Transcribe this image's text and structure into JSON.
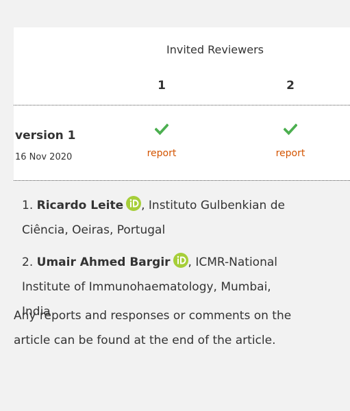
{
  "panel": {
    "heading": "Invited Reviewers",
    "reviewer_columns": [
      "1",
      "2"
    ]
  },
  "version": {
    "label": "version 1",
    "date": "16 Nov 2020",
    "reports": [
      {
        "status_icon": "checkmark-icon",
        "link_label": "report"
      },
      {
        "status_icon": "checkmark-icon",
        "link_label": "report"
      }
    ]
  },
  "reviewers": [
    {
      "number": "1.",
      "name": "Ricardo Leite",
      "orcid_icon": "orcid-icon",
      "affiliation_line1": ", Instituto Gulbenkian de",
      "affiliation_line2": "Ciência, Oeiras, Portugal"
    },
    {
      "number": "2.",
      "name": "Umair Ahmed Bargir",
      "orcid_icon": "orcid-icon",
      "affiliation_line1": ", ICMR-National",
      "affiliation_line2": "Institute of Immunohaematology, Mumbai,",
      "affiliation_line3": "India"
    }
  ],
  "footer": {
    "line1": "Any reports and responses or comments on the",
    "line2": "article can be found at the end of the article."
  },
  "colors": {
    "check": "#4caf50",
    "report_link": "#d35400",
    "orcid": "#a6ce39"
  }
}
